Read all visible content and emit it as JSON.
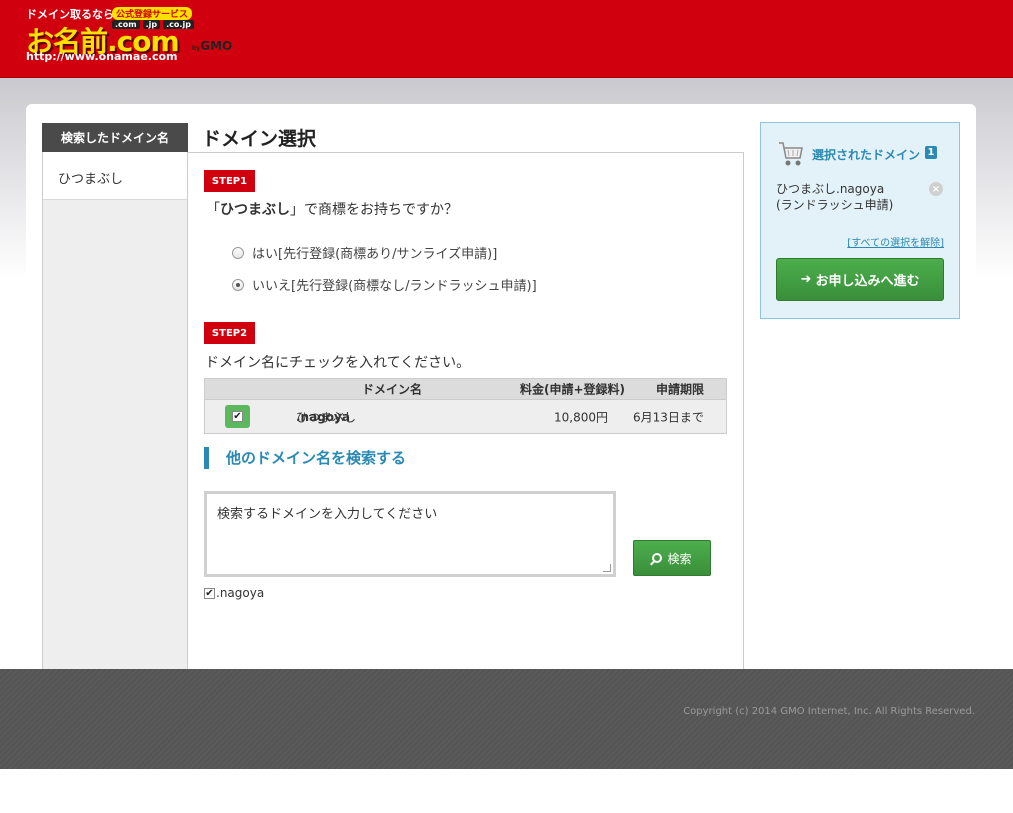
{
  "header": {
    "logo_tagline": "ドメイン取るなら",
    "logo_badge": "公式登録サービス",
    "logo_tlds": [
      ".com",
      ".jp",
      ".co.jp"
    ],
    "logo_brand": "お名前.com",
    "logo_url": "http://www.onamae.com",
    "logo_by": "by",
    "logo_gmo": "GMO",
    "brand_color": "#d0000f"
  },
  "sidebar": {
    "heading": "検索したドメイン名",
    "items": [
      {
        "label": "ひつまぶし"
      }
    ]
  },
  "main": {
    "title": "ドメイン選択",
    "step1": {
      "badge": "STEP1",
      "question_open": "「",
      "question_name": "ひつまぶし",
      "question_rest": "」で商標をお持ちですか？",
      "options": [
        {
          "label": "はい[先行登録(商標あり/サンライズ申請)]",
          "selected": false
        },
        {
          "label": "いいえ[先行登録(商標なし/ランドラッシュ申請)]",
          "selected": true
        }
      ]
    },
    "step2": {
      "badge": "STEP2",
      "instruction": "ドメイン名にチェックを入れてください。",
      "table": {
        "headers": {
          "domain": "ドメイン名",
          "price": "料金(申請+登録料)",
          "deadline": "申請期限"
        },
        "rows": [
          {
            "checked": true,
            "domain_name": "ひつまぶし",
            "domain_tld": ".nagoya",
            "price": "10,800円",
            "deadline": "6月13日まで"
          }
        ]
      }
    },
    "other_search": {
      "heading": "他のドメイン名を検索する",
      "placeholder": "検索するドメインを入力してください",
      "button_label": "検索",
      "tld_option": {
        "label": ".nagoya",
        "checked": true
      }
    }
  },
  "cart": {
    "title": "選択されたドメイン",
    "count": "1",
    "item_line1": "ひつまぶし.nagoya",
    "item_line2": "(ランドラッシュ申請)",
    "clear_label": "[すべての選択を解除]",
    "apply_label": "お申し込みへ進む",
    "accent": "#2a8ab3"
  },
  "footer": {
    "copyright": "Copyright (c) 2014 GMO Internet, Inc. All Rights Reserved."
  }
}
